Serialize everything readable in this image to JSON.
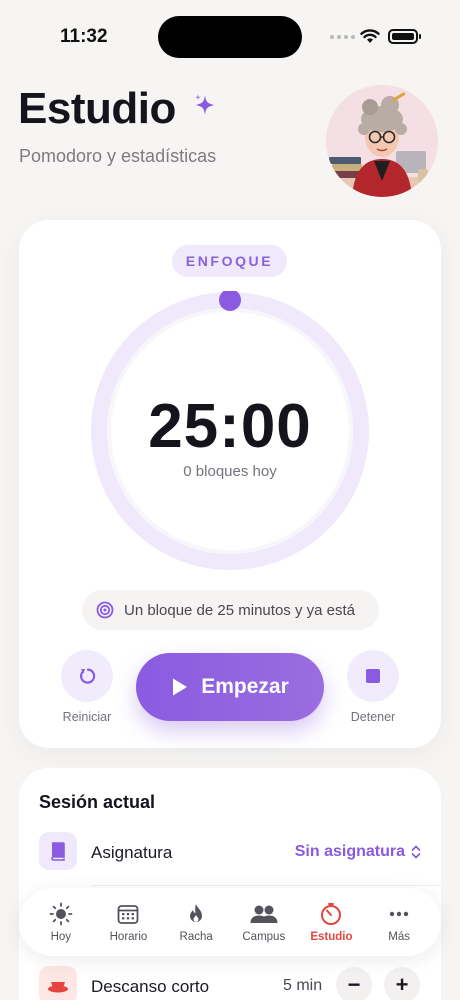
{
  "status_bar": {
    "time": "11:32"
  },
  "header": {
    "title": "Estudio",
    "subtitle": "Pomodoro y estadísticas"
  },
  "timer": {
    "mode": "ENFOQUE",
    "time": "25:00",
    "blocks_today": "0 bloques hoy",
    "progress": 0,
    "hint": "Un bloque de 25 minutos y ya está",
    "reset_label": "Reiniciar",
    "start_label": "Empezar",
    "stop_label": "Detener"
  },
  "session": {
    "title": "Sesión actual",
    "subject_label": "Asignatura",
    "subject_value": "Sin asignatura",
    "short_break_label": "Descanso corto",
    "short_break_value": "5 min",
    "minus": "−",
    "plus": "+"
  },
  "tabs": [
    {
      "label": "Hoy",
      "icon": "sun-icon"
    },
    {
      "label": "Horario",
      "icon": "calendar-icon"
    },
    {
      "label": "Racha",
      "icon": "flame-icon"
    },
    {
      "label": "Campus",
      "icon": "people-icon"
    },
    {
      "label": "Estudio",
      "icon": "timer-icon",
      "active": true
    },
    {
      "label": "Más",
      "icon": "more-icon"
    }
  ],
  "colors": {
    "accent": "#8a5be0",
    "active_tab": "#e5453e",
    "ring_track": "#efe9fb"
  }
}
